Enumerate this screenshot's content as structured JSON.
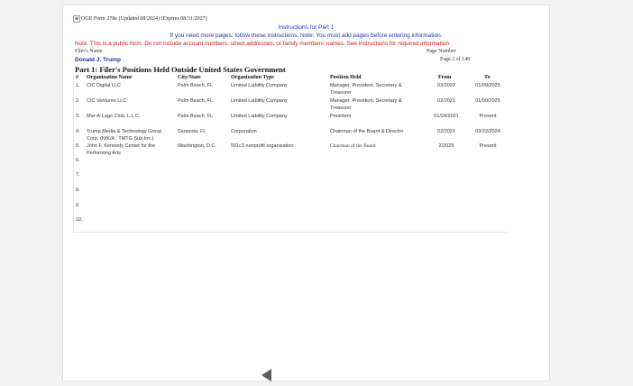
{
  "form": {
    "header": "OGE Form 278e (Updated 08/2024) (Expires 08/31/2027)",
    "instructions_title": "Instructions for Part 1",
    "instructions_line": "If you need more pages, follow these instructions. Note: You must add pages before entering information.",
    "note": "Note: This is a public form. Do not include account numbers, street addresses, or family members' names.  See instructions for required information.",
    "filer_label": "Filer's Name",
    "page_number_label": "Page Number",
    "filer_name": "Donald J. Trump",
    "page_of": "Page 2 of 148",
    "part_title": "Part 1: Filer's Positions Held Outside United States Government"
  },
  "table": {
    "headers": {
      "num": "#",
      "org": "Organization Name",
      "city": "City/State",
      "type": "Organization Type",
      "position": "Position Held",
      "from": "From",
      "to": "To"
    },
    "rows": [
      {
        "num": "1.",
        "org": "CIC Digital LLC",
        "city": "Palm Beach, FL",
        "type": "Limited Liability Company",
        "position": "Manager, President, Secretary & Treasurer",
        "from": "03/2022",
        "to": "01/09/2025"
      },
      {
        "num": "2.",
        "org": "CIC Ventures LLC",
        "city": "Palm Beach, FL",
        "type": "Limited Liability Company",
        "position": "Manager, President, Secretary & Treasurer",
        "from": "02/2021",
        "to": "01/09/2025"
      },
      {
        "num": "3.",
        "org": "Mar-A-Lago Club, L.L.C.",
        "city": "Palm Beach, FL",
        "type": "Limited Liability Company",
        "position": "President",
        "from": "01/24/2021",
        "to": "Present"
      },
      {
        "num": "4.",
        "org": "Trump Media & Technology Group Corp. (N/K/A : TMTG Sub Inc.)",
        "city": "Sarasota, FL",
        "type": "Corporation",
        "position": "Chairman of the Board & Director",
        "from": "02/2021",
        "to": "03/22/2024"
      },
      {
        "num": "5.",
        "org": "John F. Kennedy Center for the Performing Arts",
        "city": "Washington, D.C.",
        "type": "501c3 nonprofit organization",
        "position": "Chairman of the Board",
        "from": "2/2025",
        "to": "Present"
      },
      {
        "num": "6.",
        "org": "",
        "city": "",
        "type": "",
        "position": "",
        "from": "",
        "to": ""
      },
      {
        "num": "7.",
        "org": "",
        "city": "",
        "type": "",
        "position": "",
        "from": "",
        "to": ""
      },
      {
        "num": "8.",
        "org": "",
        "city": "",
        "type": "",
        "position": "",
        "from": "",
        "to": ""
      },
      {
        "num": "9.",
        "org": "",
        "city": "",
        "type": "",
        "position": "",
        "from": "",
        "to": ""
      },
      {
        "num": "10.",
        "org": "",
        "city": "",
        "type": "",
        "position": "",
        "from": "",
        "to": ""
      }
    ]
  },
  "viewer": {
    "nav_icon": "triangle-left-icon",
    "nav_color": "#5b5b5b"
  },
  "colors": {
    "instructions_blue": "#2233bb",
    "note_red": "#c8201e",
    "filer_name_blue": "#1e2e9a"
  }
}
